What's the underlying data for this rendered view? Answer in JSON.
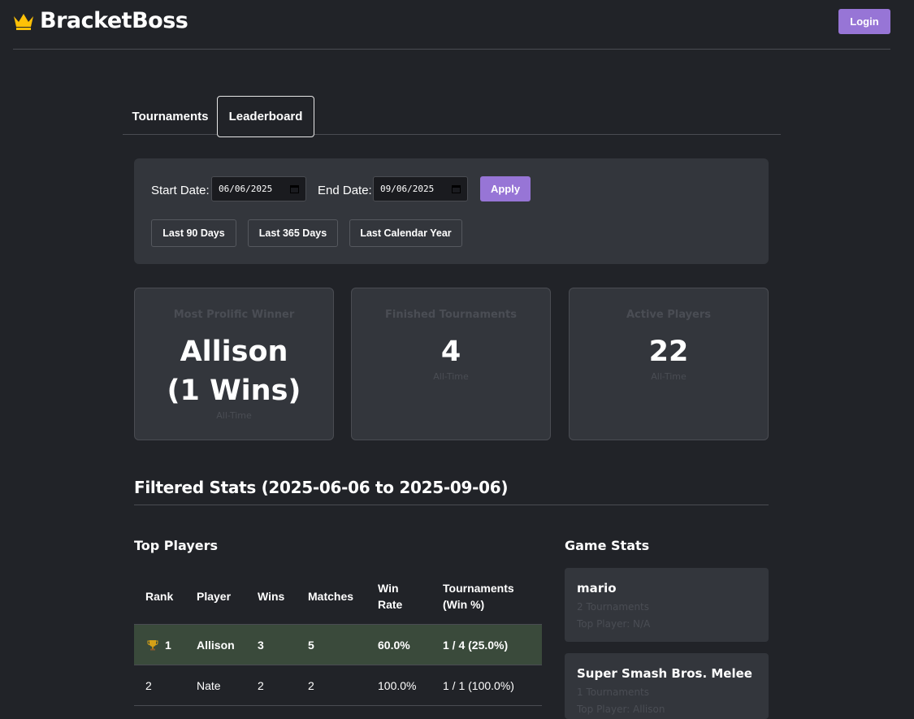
{
  "header": {
    "brand": "BracketBoss",
    "login_label": "Login",
    "brand_color": "#ffc107",
    "accent": "#9775d6"
  },
  "tabs": [
    {
      "label": "Tournaments"
    },
    {
      "label": "Leaderboard",
      "active": true
    }
  ],
  "filters": {
    "start_label": "Start Date:",
    "start_value": "06/06/2025",
    "end_label": "End Date:",
    "end_value": "09/06/2025",
    "apply_label": "Apply",
    "presets": [
      "Last 90 Days",
      "Last 365 Days",
      "Last Calendar Year"
    ]
  },
  "stats": [
    {
      "label": "Most Prolific Winner",
      "value": "Allison (1 Wins)",
      "sub": "All-Time"
    },
    {
      "label": "Finished Tournaments",
      "value": "4",
      "sub": "All-Time"
    },
    {
      "label": "Active Players",
      "value": "22",
      "sub": "All-Time"
    }
  ],
  "filtered_title": "Filtered Stats (2025-06-06 to 2025-09-06)",
  "top_players": {
    "title": "Top Players",
    "columns": [
      "Rank",
      "Player",
      "Wins",
      "Matches",
      "Win Rate",
      "Tournaments (Win %)"
    ],
    "rows": [
      {
        "rank": "1",
        "player": "Allison",
        "wins": "3",
        "matches": "5",
        "win_rate": "60.0%",
        "tournaments": "1 / 4 (25.0%)"
      },
      {
        "rank": "2",
        "player": "Nate",
        "wins": "2",
        "matches": "2",
        "win_rate": "100.0%",
        "tournaments": "1 / 1 (100.0%)"
      }
    ]
  },
  "game_stats": {
    "title": "Game Stats",
    "games": [
      {
        "name": "mario",
        "tournaments": "2 Tournaments",
        "top_player": "Top Player: N/A"
      },
      {
        "name": "Super Smash Bros. Melee",
        "tournaments": "1 Tournaments",
        "top_player": "Top Player: Allison"
      }
    ]
  }
}
